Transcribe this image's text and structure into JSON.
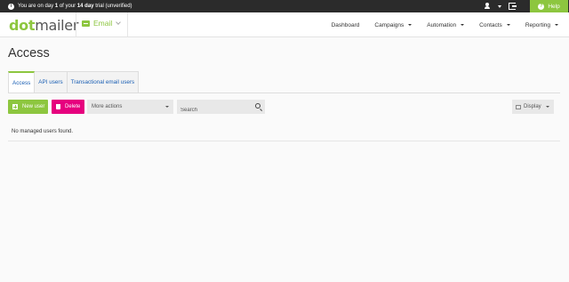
{
  "trial_bar": {
    "prefix": "You are on day ",
    "day": "1",
    "middle": " of your ",
    "length": "14 day",
    "suffix": " trial (unverified)",
    "help_label": "Help"
  },
  "header": {
    "logo_dot": "dot",
    "logo_mailer": "mailer",
    "product": "Email",
    "nav": [
      "Dashboard",
      "Campaigns",
      "Automation",
      "Contacts",
      "Reporting"
    ]
  },
  "page": {
    "title": "Access",
    "tabs": [
      "Access",
      "API users",
      "Transactional email users"
    ]
  },
  "toolbar": {
    "new_user": "New user",
    "delete": "Delete",
    "more_actions": "More actions",
    "search_placeholder": "Search",
    "display": "Display"
  },
  "empty_message": "No managed users found.",
  "colors": {
    "brand_green": "#8dc63f",
    "delete_magenta": "#e6007e",
    "link_blue": "#1a5fb4"
  },
  "icons": [
    "info-icon",
    "users-icon",
    "logout-icon",
    "help-icon",
    "email-icon",
    "plus-icon",
    "trash-icon",
    "search-icon",
    "grid-icon"
  ]
}
